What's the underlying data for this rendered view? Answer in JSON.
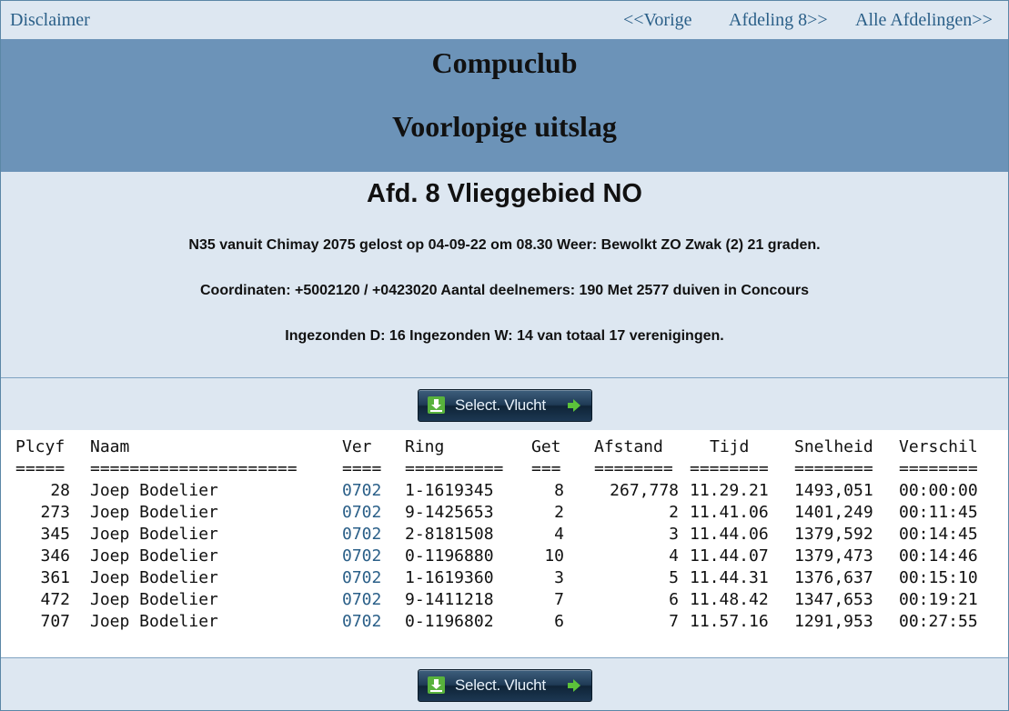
{
  "nav": {
    "disclaimer": "Disclaimer",
    "prev": "<<Vorige",
    "afdeling": "Afdeling 8>>",
    "all": "Alle Afdelingen>>"
  },
  "banner": {
    "club": "Compuclub",
    "status": "Voorlopige uitslag"
  },
  "info": {
    "title": "Afd. 8 Vlieggebied NO",
    "line1": "N35 vanuit Chimay 2075 gelost op 04-09-22 om 08.30 Weer: Bewolkt ZO Zwak (2) 21 graden.",
    "line2": "Coordinaten: +5002120 / +0423020 Aantal deelnemers: 190 Met 2577 duiven in Concours",
    "line3": "Ingezonden D: 16 Ingezonden W: 14 van totaal 17 verenigingen."
  },
  "select_button": {
    "label": "Select. Vlucht",
    "icon_left": "download-icon",
    "icon_right": "arrow-right-icon"
  },
  "colors": {
    "link": "#2a5f88",
    "banner": "#6c93b8",
    "background": "#dde7f1",
    "button_icon": "#58b23c"
  },
  "table": {
    "headers": {
      "plcyf": "Plcyf",
      "naam": "Naam",
      "ver": "Ver",
      "ring": "Ring",
      "get": "Get",
      "afstand": "Afstand",
      "tijd": "Tijd",
      "snelheid": "Snelheid",
      "verschil": "Verschil"
    },
    "separators": {
      "plcyf": "=====",
      "naam": "=====================",
      "ver": "====",
      "ring": "==========",
      "get": "===",
      "afstand": "========",
      "tijd": "========",
      "snelheid": "========",
      "verschil": "========"
    },
    "rows": [
      {
        "plcyf": "28",
        "naam": "Joep Bodelier",
        "ver": "0702",
        "ring": "1-1619345",
        "get": "8",
        "afstand": "267,778",
        "tijd": "11.29.21",
        "snelheid": "1493,051",
        "verschil": "00:00:00"
      },
      {
        "plcyf": "273",
        "naam": "Joep Bodelier",
        "ver": "0702",
        "ring": "9-1425653",
        "get": "2",
        "afstand": "2",
        "tijd": "11.41.06",
        "snelheid": "1401,249",
        "verschil": "00:11:45"
      },
      {
        "plcyf": "345",
        "naam": "Joep Bodelier",
        "ver": "0702",
        "ring": "2-8181508",
        "get": "4",
        "afstand": "3",
        "tijd": "11.44.06",
        "snelheid": "1379,592",
        "verschil": "00:14:45"
      },
      {
        "plcyf": "346",
        "naam": "Joep Bodelier",
        "ver": "0702",
        "ring": "0-1196880",
        "get": "10",
        "afstand": "4",
        "tijd": "11.44.07",
        "snelheid": "1379,473",
        "verschil": "00:14:46"
      },
      {
        "plcyf": "361",
        "naam": "Joep Bodelier",
        "ver": "0702",
        "ring": "1-1619360",
        "get": "3",
        "afstand": "5",
        "tijd": "11.44.31",
        "snelheid": "1376,637",
        "verschil": "00:15:10"
      },
      {
        "plcyf": "472",
        "naam": "Joep Bodelier",
        "ver": "0702",
        "ring": "9-1411218",
        "get": "7",
        "afstand": "6",
        "tijd": "11.48.42",
        "snelheid": "1347,653",
        "verschil": "00:19:21"
      },
      {
        "plcyf": "707",
        "naam": "Joep Bodelier",
        "ver": "0702",
        "ring": "0-1196802",
        "get": "6",
        "afstand": "7",
        "tijd": "11.57.16",
        "snelheid": "1291,953",
        "verschil": "00:27:55"
      }
    ]
  }
}
